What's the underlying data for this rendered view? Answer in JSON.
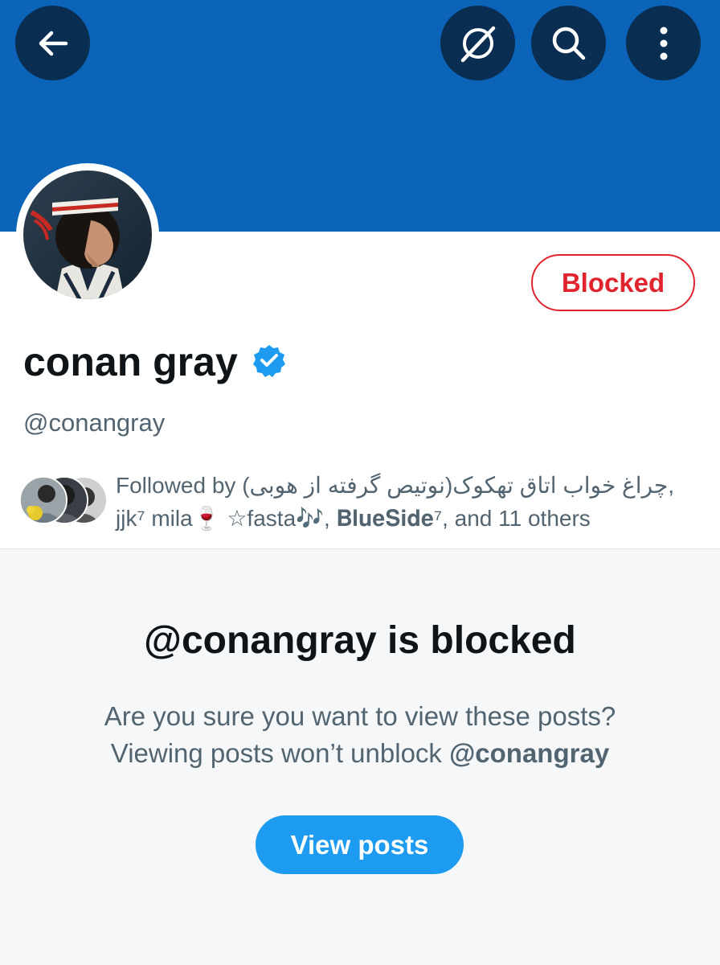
{
  "header": {
    "back_icon": "arrow-left-icon",
    "grok_icon": "grok-icon",
    "search_icon": "search-icon",
    "more_icon": "more-vertical-icon",
    "banner_color": "#0c64b8"
  },
  "profile": {
    "name": "conan gray",
    "handle": "@conangray",
    "verified": true,
    "blocked_label": "Blocked",
    "followed_by": {
      "prefix": "Followed by ",
      "names_line1": "(نوتیص گرفته از هوبی)چراغ خواب اتاق تهکوک,",
      "names_line2": "jjk⁷ mila🍷 ☆fasta🎶, 𝐁𝐥𝐮𝐞𝐒𝐢𝐝𝐞⁷, and 11 others"
    }
  },
  "blocked_notice": {
    "title": "@conangray is blocked",
    "line1": "Are you sure you want to view these posts?",
    "line2_prefix": "Viewing posts won’t unblock ",
    "line2_handle": "@conangray",
    "button_label": "View posts"
  },
  "colors": {
    "accent": "#1d9bf0",
    "blocked_red": "#e0242e",
    "verified_blue": "#1d9bf0"
  }
}
